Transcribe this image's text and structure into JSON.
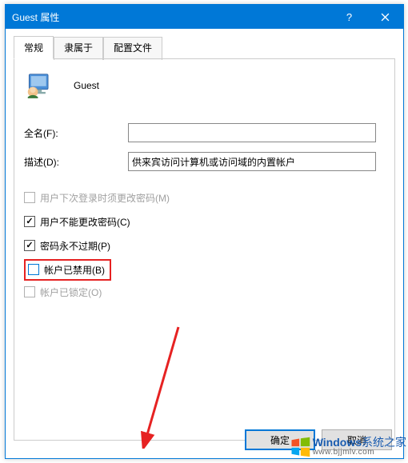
{
  "title": "Guest 属性",
  "tabs": {
    "t0": "常规",
    "t1": "隶属于",
    "t2": "配置文件"
  },
  "user": {
    "name": "Guest"
  },
  "fields": {
    "fullname_label": "全名(F):",
    "fullname_value": "",
    "desc_label": "描述(D):",
    "desc_value": "供来宾访问计算机或访问域的内置帐户"
  },
  "checkboxes": {
    "c1": "用户下次登录时须更改密码(M)",
    "c2": "用户不能更改密码(C)",
    "c3": "密码永不过期(P)",
    "c4": "帐户已禁用(B)",
    "c5": "帐户已锁定(O)"
  },
  "buttons": {
    "ok": "确定",
    "cancel": "取消"
  },
  "watermark": {
    "brand": "Windows",
    "suffix": "系统之家",
    "url": "www.bjjmlv.com"
  }
}
